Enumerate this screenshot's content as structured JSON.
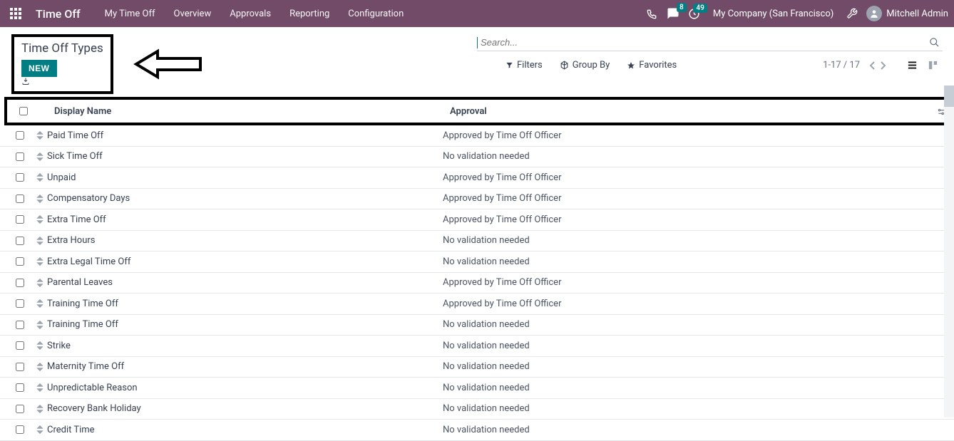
{
  "navbar": {
    "app_name": "Time Off",
    "links": [
      "My Time Off",
      "Overview",
      "Approvals",
      "Reporting",
      "Configuration"
    ],
    "messages_badge": "8",
    "activities_badge": "49",
    "company": "My Company (San Francisco)",
    "user_name": "Mitchell Admin"
  },
  "control_panel": {
    "title": "Time Off Types",
    "new_button": "NEW",
    "search_placeholder": "Search...",
    "filters_label": "Filters",
    "groupby_label": "Group By",
    "favorites_label": "Favorites",
    "pager": "1-17 / 17"
  },
  "table": {
    "columns": {
      "display_name": "Display Name",
      "approval": "Approval"
    },
    "rows": [
      {
        "display_name": "Paid Time Off",
        "approval": "Approved by Time Off Officer"
      },
      {
        "display_name": "Sick Time Off",
        "approval": "No validation needed"
      },
      {
        "display_name": "Unpaid",
        "approval": "Approved by Time Off Officer"
      },
      {
        "display_name": "Compensatory Days",
        "approval": "Approved by Time Off Officer"
      },
      {
        "display_name": "Extra Time Off",
        "approval": "Approved by Time Off Officer"
      },
      {
        "display_name": "Extra Hours",
        "approval": "No validation needed"
      },
      {
        "display_name": "Extra Legal Time Off",
        "approval": "No validation needed"
      },
      {
        "display_name": "Parental Leaves",
        "approval": "Approved by Time Off Officer"
      },
      {
        "display_name": "Training Time Off",
        "approval": "Approved by Time Off Officer"
      },
      {
        "display_name": "Training Time Off",
        "approval": "No validation needed"
      },
      {
        "display_name": "Strike",
        "approval": "No validation needed"
      },
      {
        "display_name": "Maternity Time Off",
        "approval": "No validation needed"
      },
      {
        "display_name": "Unpredictable Reason",
        "approval": "No validation needed"
      },
      {
        "display_name": "Recovery Bank Holiday",
        "approval": "No validation needed"
      },
      {
        "display_name": "Credit Time",
        "approval": "No validation needed"
      }
    ]
  }
}
